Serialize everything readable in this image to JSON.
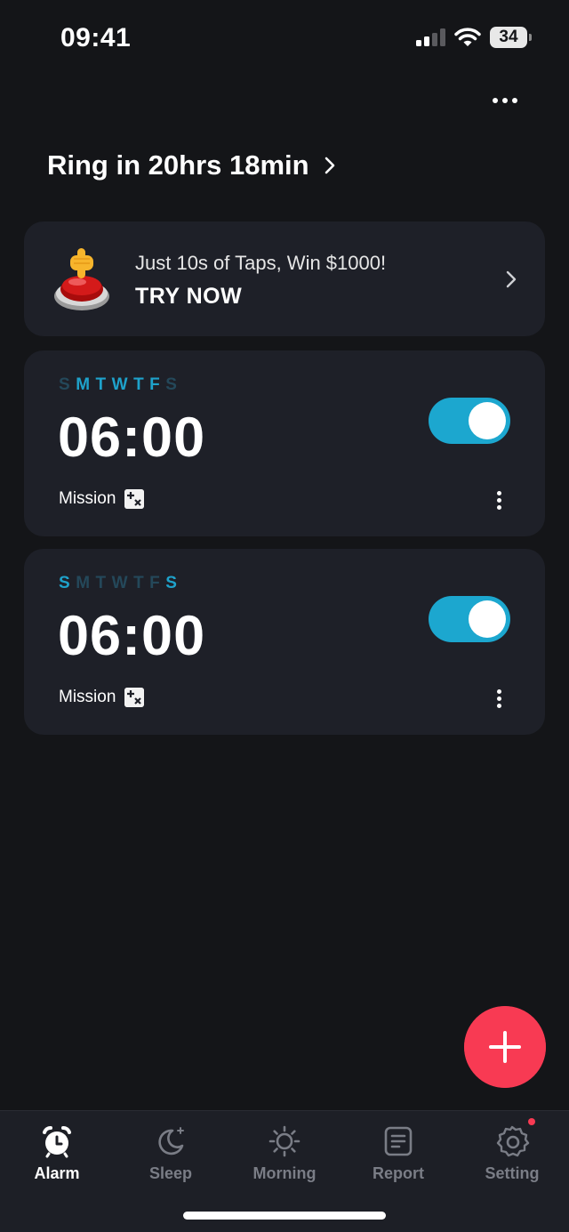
{
  "status_bar": {
    "time": "09:41",
    "battery": "34",
    "icons": [
      "signal-icon",
      "wifi-icon",
      "battery-icon"
    ]
  },
  "header": {
    "ring_in": "Ring in 20hrs 18min",
    "more_icon": "more-horizontal-icon"
  },
  "promo": {
    "title": "Just 10s of Taps, Win $1000!",
    "cta": "TRY NOW",
    "icon": "red-button-tap-icon"
  },
  "alarms": [
    {
      "time": "06:00",
      "days": [
        {
          "letter": "S",
          "active": false
        },
        {
          "letter": "M",
          "active": true
        },
        {
          "letter": "T",
          "active": true
        },
        {
          "letter": "W",
          "active": true
        },
        {
          "letter": "T",
          "active": true
        },
        {
          "letter": "F",
          "active": true
        },
        {
          "letter": "S",
          "active": false
        }
      ],
      "enabled": true,
      "mission_label": "Mission"
    },
    {
      "time": "06:00",
      "days": [
        {
          "letter": "S",
          "active": true
        },
        {
          "letter": "M",
          "active": false
        },
        {
          "letter": "T",
          "active": false
        },
        {
          "letter": "W",
          "active": false
        },
        {
          "letter": "T",
          "active": false
        },
        {
          "letter": "F",
          "active": false
        },
        {
          "letter": "S",
          "active": true
        }
      ],
      "enabled": true,
      "mission_label": "Mission"
    }
  ],
  "tabs": [
    {
      "label": "Alarm",
      "icon": "alarm-clock-icon",
      "active": true
    },
    {
      "label": "Sleep",
      "icon": "moon-icon",
      "active": false
    },
    {
      "label": "Morning",
      "icon": "sun-icon",
      "active": false
    },
    {
      "label": "Report",
      "icon": "report-icon",
      "active": false
    },
    {
      "label": "Setting",
      "icon": "gear-icon",
      "active": false
    }
  ],
  "colors": {
    "background": "#141518",
    "card": "#1e2028",
    "accent": "#1ca7cf",
    "fab": "#f83a53",
    "day_inactive": "#24485a"
  }
}
